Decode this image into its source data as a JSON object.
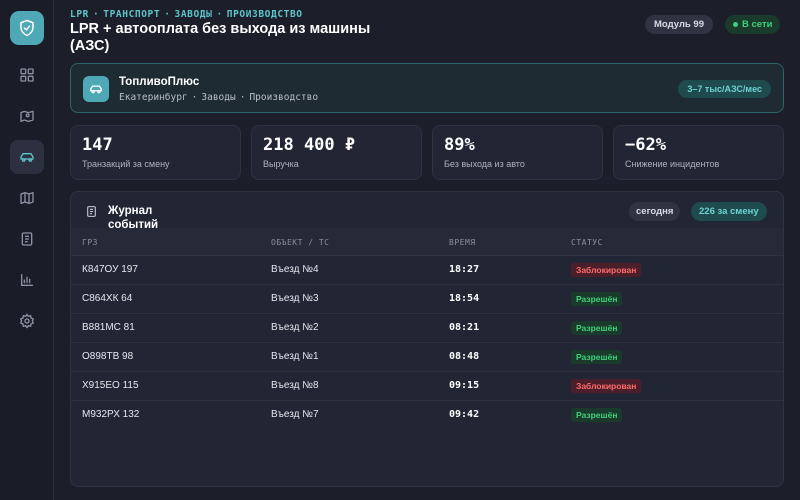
{
  "breadcrumbs": [
    "LPR",
    "ТРАНСПОРТ",
    "ЗАВОДЫ",
    "ПРОИЗВОДСТВО"
  ],
  "title": "LPR + автооплата без выхода из машины (АЗС)",
  "header": {
    "module_label": "Модуль 99",
    "status_label": "В сети"
  },
  "company": {
    "name": "ТопливоПлюс",
    "details": [
      "Екатеринбург",
      "Заводы",
      "Производство"
    ],
    "badge": "3–7 тыс/АЗС/мес"
  },
  "kpis": [
    {
      "value": "147",
      "label": "Транзакций за смену"
    },
    {
      "value": "218 400 ₽",
      "label": "Выручка"
    },
    {
      "value": "89%",
      "label": "Без выхода из авто"
    },
    {
      "value": "−62%",
      "label": "Снижение инцидентов"
    }
  ],
  "journal": {
    "title": "Журнал событий",
    "filter_label": "сегодня",
    "count_label": "226 за смену",
    "columns": [
      "ГРЗ",
      "ОБЪЕКТ / ТС",
      "ВРЕМЯ",
      "СТАТУС"
    ],
    "rows": [
      {
        "plate": "К847ОУ 197",
        "object": "Въезд №4",
        "time": "18:27",
        "status": "Заблокирован",
        "status_type": "blocked"
      },
      {
        "plate": "С864ХК 64",
        "object": "Въезд №3",
        "time": "18:54",
        "status": "Разрешён",
        "status_type": "ok"
      },
      {
        "plate": "В881МС 81",
        "object": "Въезд №2",
        "time": "08:21",
        "status": "Разрешён",
        "status_type": "ok"
      },
      {
        "plate": "О898ТВ 98",
        "object": "Въезд №1",
        "time": "08:48",
        "status": "Разрешён",
        "status_type": "ok"
      },
      {
        "plate": "Х915ЕО 115",
        "object": "Въезд №8",
        "time": "09:15",
        "status": "Заблокирован",
        "status_type": "blocked"
      },
      {
        "plate": "М932РХ 132",
        "object": "Въезд №7",
        "time": "09:42",
        "status": "Разрешён",
        "status_type": "ok"
      }
    ]
  },
  "colors": {
    "accent": "#4fa8b5",
    "teal_text": "#5cc6c9",
    "success": "#3fd07c",
    "danger": "#ff6b6b",
    "background": "#1c1e2a"
  },
  "icons": [
    "shield-check-icon",
    "dashboard-icon",
    "map-pin-icon",
    "car-icon",
    "map-icon",
    "document-icon",
    "chart-icon",
    "gear-icon"
  ]
}
